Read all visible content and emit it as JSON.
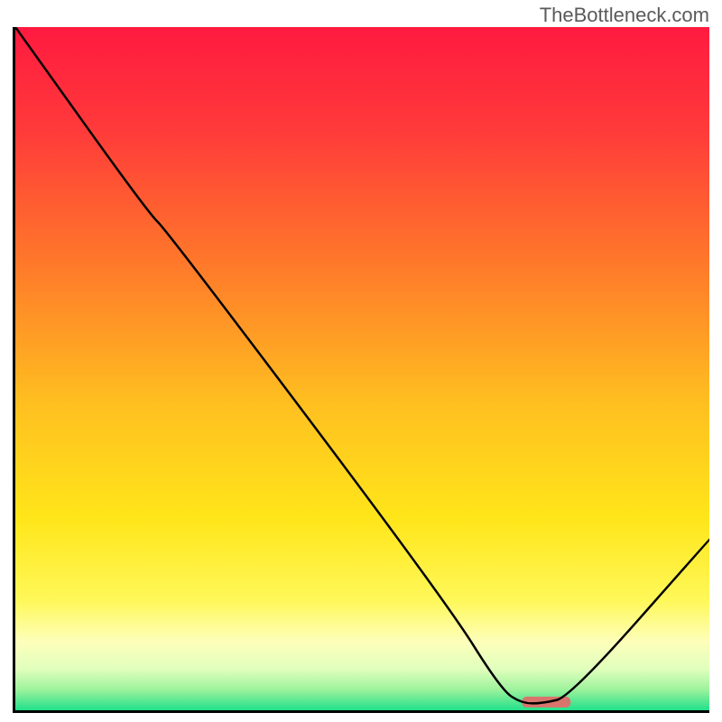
{
  "watermark": "TheBottleneck.com",
  "chart_data": {
    "type": "line",
    "title": "",
    "xlabel": "",
    "ylabel": "",
    "xlim": [
      0,
      100
    ],
    "ylim": [
      0,
      100
    ],
    "gradient_stops": [
      {
        "offset": 0.0,
        "color": "#ff1a40"
      },
      {
        "offset": 0.15,
        "color": "#ff3a3a"
      },
      {
        "offset": 0.35,
        "color": "#ff7a2a"
      },
      {
        "offset": 0.55,
        "color": "#ffbf20"
      },
      {
        "offset": 0.72,
        "color": "#ffe61a"
      },
      {
        "offset": 0.84,
        "color": "#fff85a"
      },
      {
        "offset": 0.9,
        "color": "#fdffbb"
      },
      {
        "offset": 0.94,
        "color": "#e0ffbc"
      },
      {
        "offset": 0.97,
        "color": "#9cf29c"
      },
      {
        "offset": 1.0,
        "color": "#21e08a"
      }
    ],
    "curve": {
      "x": [
        0,
        19,
        22,
        62,
        70,
        73,
        76,
        80,
        100
      ],
      "y_value": [
        100,
        73,
        70,
        16,
        3,
        1,
        1,
        2,
        25
      ]
    },
    "marker": {
      "x_start": 73,
      "x_end": 80,
      "y": 1.2,
      "fill": "#d9746c"
    }
  }
}
